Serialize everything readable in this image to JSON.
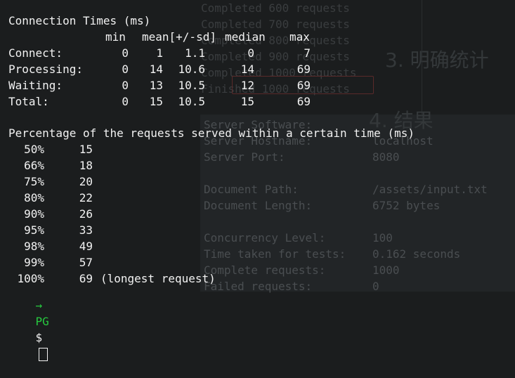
{
  "background": {
    "log_lines": [
      "Completed 600 requests",
      "Completed 700 requests",
      "Completed 800 requests",
      "Completed 900 requests",
      "Completed 1000 requests",
      "Finished 1000 requests"
    ],
    "heading_partial": "3. 明确统计",
    "heading_partial2": "4. 结果",
    "server_info": [
      {
        "k": "Server Software:",
        "v": ""
      },
      {
        "k": "Server Hostname:",
        "v": "localhost"
      },
      {
        "k": "Server Port:",
        "v": "8080"
      },
      {
        "k": "",
        "v": ""
      },
      {
        "k": "Document Path:",
        "v": "/assets/input.txt"
      },
      {
        "k": "Document Length:",
        "v": "6752 bytes"
      },
      {
        "k": "",
        "v": ""
      },
      {
        "k": "Concurrency Level:",
        "v": "100"
      },
      {
        "k": "Time taken for tests:",
        "v": "0.162 seconds"
      },
      {
        "k": "Complete requests:",
        "v": "1000"
      },
      {
        "k": "Failed requests:",
        "v": "0"
      }
    ]
  },
  "terminal": {
    "conn_title": "Connection Times (ms)",
    "headers": {
      "min": "min",
      "mean": "mean[+/-sd]",
      "median": "median",
      "max": "max"
    },
    "rows": [
      {
        "label": "Connect:",
        "min": "0",
        "mean": "1",
        "sd": "1.1",
        "median": "0",
        "max": "7"
      },
      {
        "label": "Processing:",
        "min": "0",
        "mean": "14",
        "sd": "10.6",
        "median": "14",
        "max": "69"
      },
      {
        "label": "Waiting:",
        "min": "0",
        "mean": "13",
        "sd": "10.5",
        "median": "12",
        "max": "69"
      },
      {
        "label": "Total:",
        "min": "0",
        "mean": "15",
        "sd": "10.5",
        "median": "15",
        "max": "69"
      }
    ],
    "pct_title": "Percentage of the requests served within a certain time (ms)",
    "percentiles": [
      {
        "p": "50%",
        "v": "15",
        "note": ""
      },
      {
        "p": "66%",
        "v": "18",
        "note": ""
      },
      {
        "p": "75%",
        "v": "20",
        "note": ""
      },
      {
        "p": "80%",
        "v": "22",
        "note": ""
      },
      {
        "p": "90%",
        "v": "26",
        "note": ""
      },
      {
        "p": "95%",
        "v": "33",
        "note": ""
      },
      {
        "p": "98%",
        "v": "49",
        "note": ""
      },
      {
        "p": "99%",
        "v": "57",
        "note": ""
      },
      {
        "p": "100%",
        "v": "69",
        "note": "(longest request)"
      }
    ],
    "prompt": {
      "left": "→",
      "mid": "PG",
      "sym": "$"
    }
  }
}
